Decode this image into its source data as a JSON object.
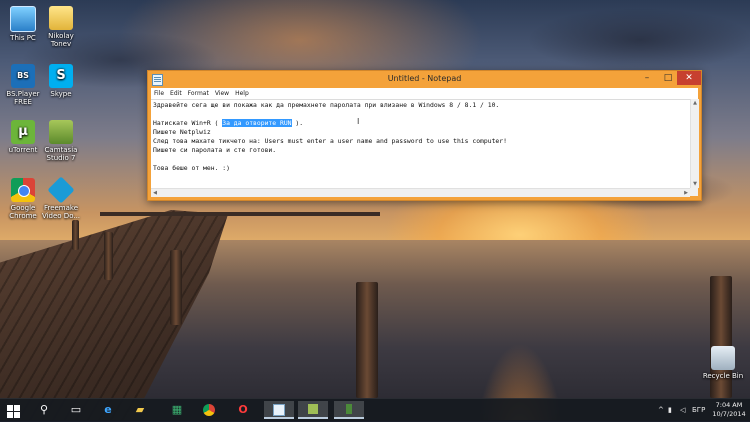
{
  "desktop": {
    "icons": [
      {
        "label": "This PC",
        "icon": "computer-icon"
      },
      {
        "label": "Nikolay Tonev",
        "icon": "user-folder-icon"
      },
      {
        "label": "BS.Player FREE",
        "icon": "bsplayer-icon"
      },
      {
        "label": "Skype",
        "icon": "skype-icon"
      },
      {
        "label": "uTorrent",
        "icon": "utorrent-icon"
      },
      {
        "label": "Camtasia Studio 7",
        "icon": "camtasia-icon"
      },
      {
        "label": "Google Chrome",
        "icon": "chrome-icon"
      },
      {
        "label": "Freemake Video Do...",
        "icon": "freemake-icon"
      },
      {
        "label": "Recycle Bin",
        "icon": "recycle-bin-icon"
      }
    ]
  },
  "notepad": {
    "title": "Untitled - Notepad",
    "menu": [
      "File",
      "Edit",
      "Format",
      "View",
      "Help"
    ],
    "lines": [
      "Здравейте сега ще ви покажа как да премахнете паролата при влизане в Windows 8 / 8.1 / 10.",
      "",
      {
        "before": "Натискате Win+R ( ",
        "selected": "За да отворите RUN",
        "after": " )."
      },
      "Пишете Netplwiz",
      "След това махате тикчето на: Users must enter a user name and password to use this computer!",
      "Пишете си паролата и сте готови.",
      "",
      "Това беше от мен. :)"
    ],
    "buttons": {
      "minimize": "–",
      "maximize": "□",
      "close": "✕"
    }
  },
  "taskbar": {
    "pinned": [
      "start-icon",
      "search-icon",
      "task-view-icon",
      "internet-explorer-icon",
      "file-explorer-icon",
      "store-icon",
      "chrome-icon",
      "opera-icon",
      "notepad-icon",
      "camtasia-icon",
      "recorder-icon"
    ],
    "language": "БГР",
    "time": "7:04 AM",
    "date": "10/7/2014"
  },
  "colors": {
    "titlebar": "#f4a23a",
    "selection": "#3399ff",
    "close_button": "#c7402f"
  }
}
